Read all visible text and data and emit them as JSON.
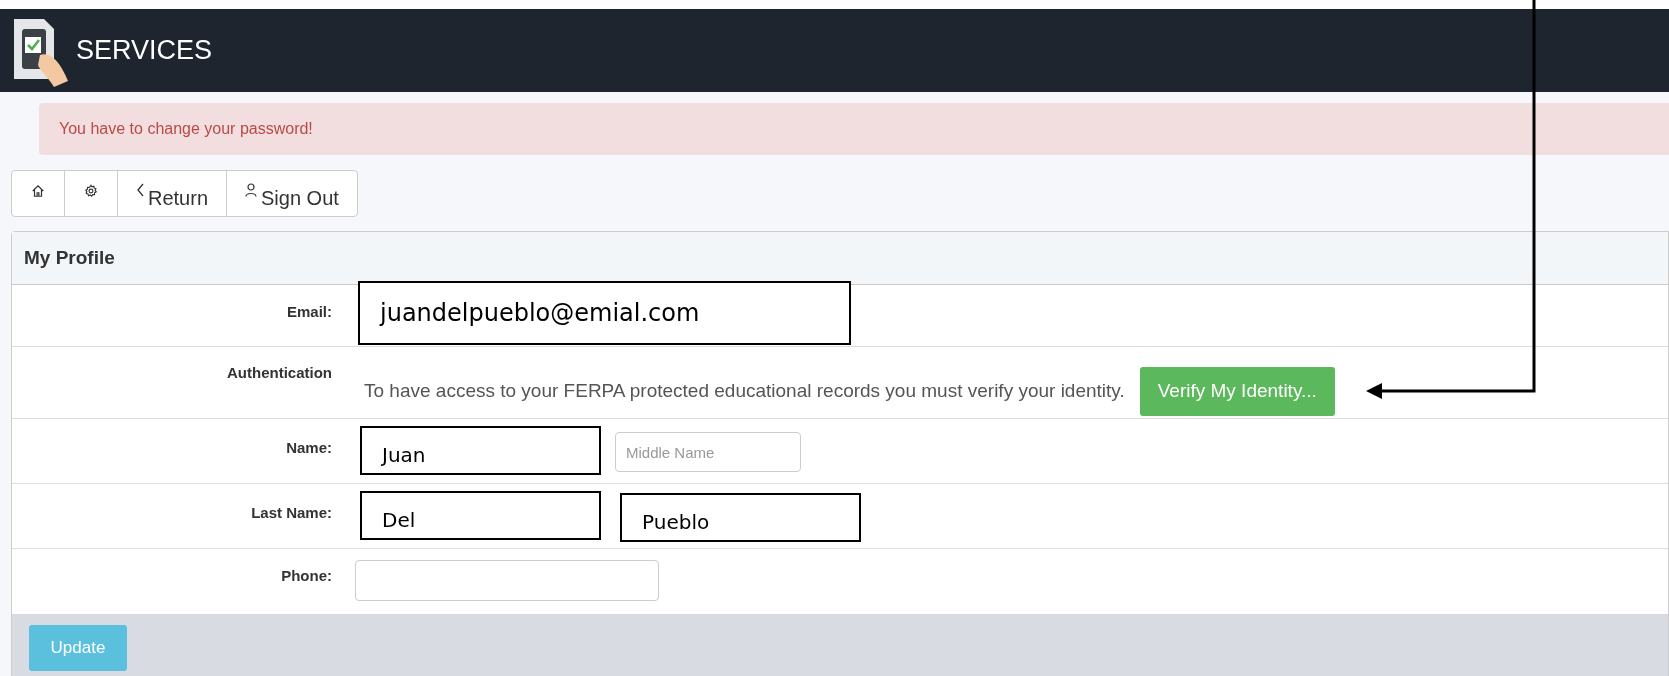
{
  "header": {
    "title": "SERVICES"
  },
  "alert": {
    "text": "You have to change your password!"
  },
  "toolbar": [
    {
      "kind": "home"
    },
    {
      "kind": "settings"
    },
    {
      "kind": "return",
      "label": "Return"
    },
    {
      "kind": "signout",
      "label": "Sign Out"
    }
  ],
  "panel": {
    "title": "My Profile",
    "rows": [
      {
        "kind": "email",
        "label": "Email:",
        "value": "juandelpueblo@emial.com"
      },
      {
        "kind": "auth",
        "label": "Authentication",
        "text": "To have access to your FERPA protected educational records you must verify your identity.",
        "button": "Verify My Identity..."
      },
      {
        "kind": "inputs",
        "label": "Name:",
        "inputs": [
          {
            "value": "Juan"
          },
          {
            "placeholder": "Middle Name"
          }
        ]
      },
      {
        "kind": "inputs",
        "label": "Last Name:",
        "inputs": [
          {
            "value": "Del"
          },
          {
            "value": "Pueblo"
          }
        ]
      },
      {
        "kind": "phone",
        "label": "Phone:"
      }
    ],
    "button": "Update"
  }
}
